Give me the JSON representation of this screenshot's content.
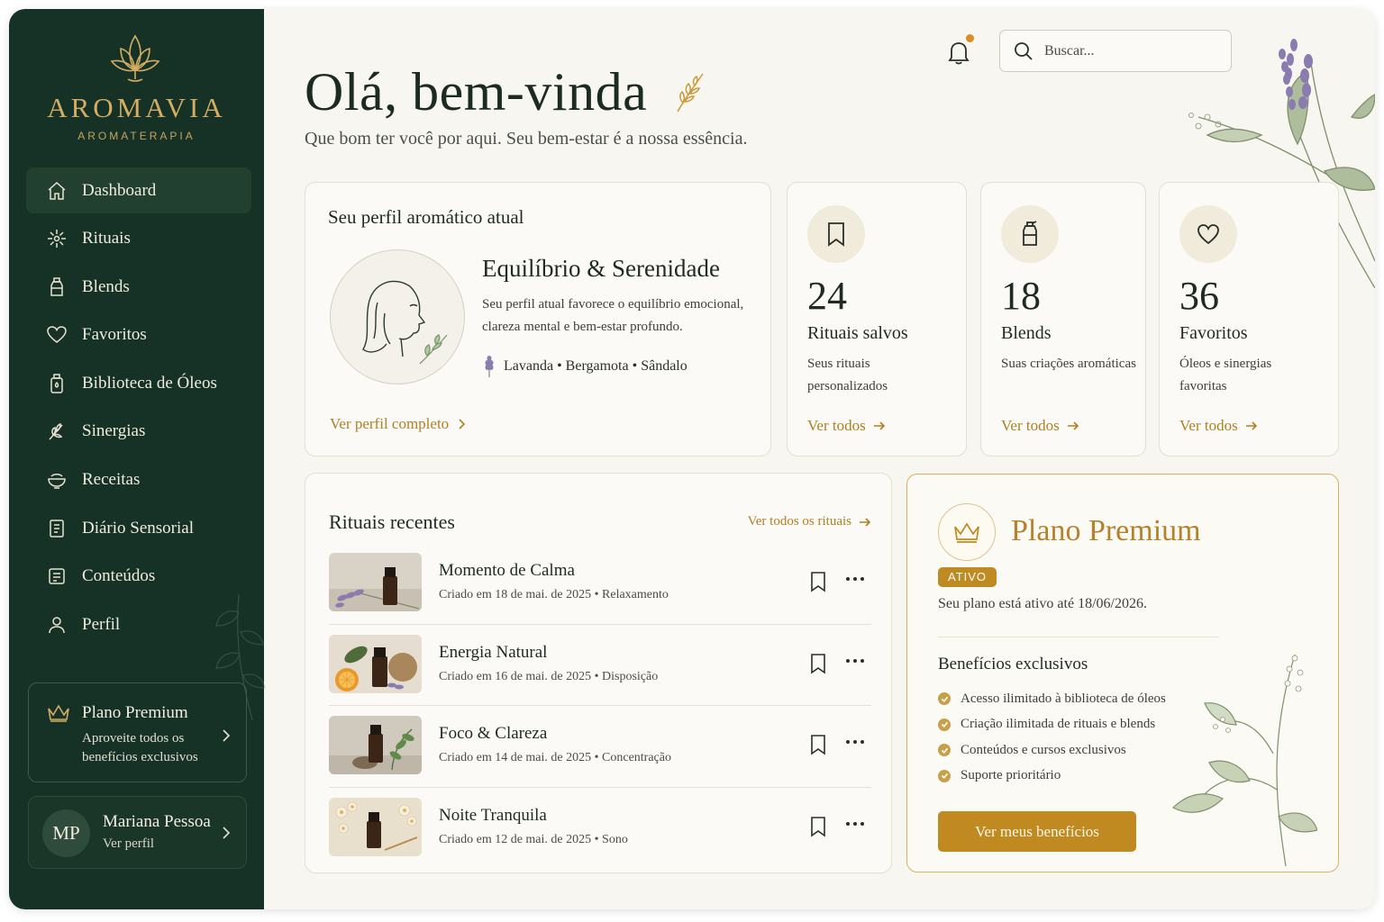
{
  "brand": {
    "name": "AROMAVIA",
    "tagline": "AROMATERAPIA"
  },
  "sidebar": {
    "items": [
      {
        "label": "Dashboard",
        "icon": "home-icon",
        "active": true
      },
      {
        "label": "Rituais",
        "icon": "sparkle-icon"
      },
      {
        "label": "Blends",
        "icon": "bottle-icon"
      },
      {
        "label": "Favoritos",
        "icon": "heart-icon"
      },
      {
        "label": "Biblioteca de Óleos",
        "icon": "oil-library-icon"
      },
      {
        "label": "Sinergias",
        "icon": "herb-icon"
      },
      {
        "label": "Receitas",
        "icon": "bowl-icon"
      },
      {
        "label": "Diário Sensorial",
        "icon": "journal-icon"
      },
      {
        "label": "Conteúdos",
        "icon": "content-icon"
      },
      {
        "label": "Perfil",
        "icon": "user-icon"
      }
    ],
    "premium": {
      "title": "Plano Premium",
      "text": "Aproveite todos os benefícios exclusivos"
    },
    "user": {
      "initials": "MP",
      "name": "Mariana Pessoa",
      "link": "Ver perfil"
    }
  },
  "header": {
    "search_placeholder": "Buscar...",
    "has_notification": true
  },
  "greeting": {
    "title": "Olá, bem-vinda",
    "subtitle": "Que bom ter você por aqui. Seu bem-estar é a nossa essência."
  },
  "profile": {
    "heading": "Seu perfil aromático atual",
    "title": "Equilíbrio & Serenidade",
    "description": "Seu perfil atual favorece o equilíbrio emocional, clareza mental e bem-estar profundo.",
    "notes": "Lavanda • Bergamota • Sândalo",
    "link": "Ver perfil completo"
  },
  "stats": [
    {
      "icon": "bookmark-icon",
      "number": "24",
      "label": "Rituais salvos",
      "desc": "Seus rituais personalizados",
      "link": "Ver todos"
    },
    {
      "icon": "bottle-icon",
      "number": "18",
      "label": "Blends",
      "desc": "Suas criações aromáticas",
      "link": "Ver todos"
    },
    {
      "icon": "heart-icon",
      "number": "36",
      "label": "Favoritos",
      "desc": "Óleos e sinergias favoritas",
      "link": "Ver todos"
    }
  ],
  "recent": {
    "title": "Rituais recentes",
    "see_all": "Ver todos os rituais",
    "items": [
      {
        "name": "Momento de Calma",
        "meta": "Criado em 18 de mai. de 2025  •  Relaxamento",
        "thumb": "lavender"
      },
      {
        "name": "Energia Natural",
        "meta": "Criado em 16 de mai. de 2025  •  Disposição",
        "thumb": "orange"
      },
      {
        "name": "Foco & Clareza",
        "meta": "Criado em 14 de mai. de 2025  •  Concentração",
        "thumb": "stone"
      },
      {
        "name": "Noite Tranquila",
        "meta": "Criado em 12 de mai. de 2025  •  Sono",
        "thumb": "flowers"
      }
    ]
  },
  "premium": {
    "title": "Plano Premium",
    "badge": "ATIVO",
    "valid_until": "Seu plano está ativo até 18/06/2026.",
    "benefits_title": "Benefícios exclusivos",
    "benefits": [
      "Acesso ilimitado à biblioteca de óleos",
      "Criação ilimitada de rituais e blends",
      "Conteúdos e cursos exclusivos",
      "Suporte prioritário"
    ],
    "button": "Ver meus benefícios"
  },
  "colors": {
    "sidebar": "#163126",
    "accent": "#c08a22",
    "background": "#f8f6f1",
    "card": "#fbfaf6"
  }
}
